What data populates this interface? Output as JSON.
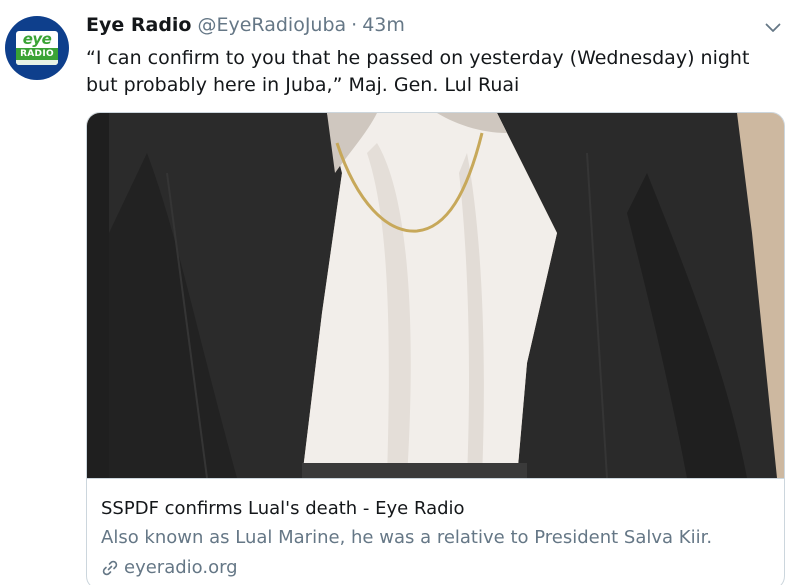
{
  "tweet": {
    "display_name": "Eye Radio",
    "handle": "@EyeRadioJuba",
    "separator": "·",
    "time": "43m",
    "text": "“I can confirm to you that he passed on yesterday (Wednesday) night but probably here in Juba,” Maj. Gen. Lul Ruai",
    "menu_icon": "chevron-down-icon"
  },
  "avatar": {
    "logo_top": "eye",
    "logo_bottom": "RADIO",
    "brand_blue": "#0e3f8c",
    "brand_green": "#3aa335"
  },
  "card": {
    "title": "SSPDF confirms Lual's death - Eye Radio",
    "description": "Also known as Lual Marine, he was a relative to President Salva Kiir.",
    "domain": "eyeradio.org",
    "link_icon": "link-icon",
    "image_subject": "man-in-dark-suit-white-shirt"
  },
  "colors": {
    "text_primary": "#14171a",
    "text_secondary": "#657786",
    "border": "#ccd6dd"
  }
}
